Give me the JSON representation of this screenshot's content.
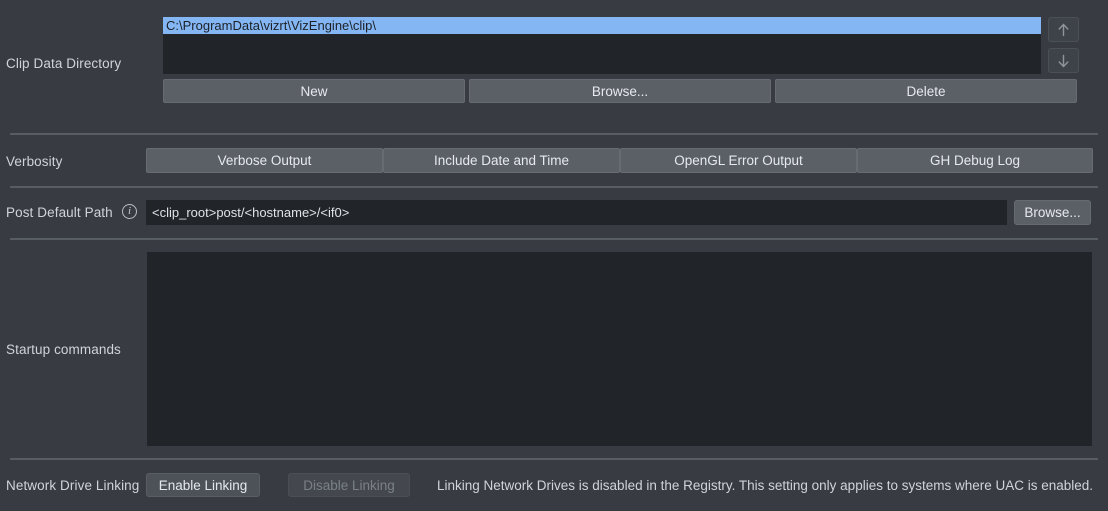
{
  "theme": {
    "background": "#383c42",
    "field_background": "#212428",
    "button_background": "#5b6066",
    "selection_blue": "#84b6f4",
    "text": "#d3d7dc",
    "disabled_text": "#7a8089",
    "separator": "#585d64"
  },
  "clip_data_directory": {
    "label": "Clip Data Directory",
    "list_items": [
      {
        "value": "C:\\ProgramData\\vizrt\\VizEngine\\clip\\",
        "selected": true
      }
    ],
    "move_up_icon": "arrow-up-icon",
    "move_down_icon": "arrow-down-icon",
    "buttons": [
      {
        "label": "New",
        "name": "new-button"
      },
      {
        "label": "Browse...",
        "name": "browse-button"
      },
      {
        "label": "Delete",
        "name": "delete-button"
      }
    ]
  },
  "verbosity": {
    "label": "Verbosity",
    "options": [
      {
        "label": "Verbose Output",
        "name": "verbose-output-toggle"
      },
      {
        "label": "Include Date and Time",
        "name": "include-date-and-time-toggle"
      },
      {
        "label": "OpenGL Error Output",
        "name": "opengl-error-output-toggle"
      },
      {
        "label": "GH Debug Log",
        "name": "gh-debug-log-toggle"
      }
    ]
  },
  "post_default_path": {
    "label": "Post Default Path",
    "info_icon": "info-icon",
    "value": "<clip_root>post/<hostname>/<if0>",
    "placeholder": "",
    "browse_label": "Browse..."
  },
  "startup_commands": {
    "label": "Startup commands",
    "value": "",
    "placeholder": ""
  },
  "network_drive_linking": {
    "label": "Network Drive Linking",
    "enable_label": "Enable Linking",
    "disable_label": "Disable Linking",
    "disable_enabled": false,
    "status": "Linking Network Drives is disabled in the Registry. This setting only applies to systems where UAC is enabled."
  }
}
